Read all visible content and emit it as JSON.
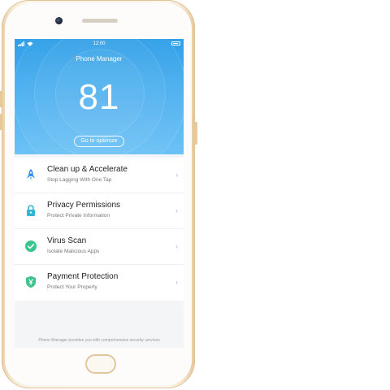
{
  "status_bar": {
    "time": "12:00"
  },
  "header": {
    "title": "Phone Manager",
    "score": "81",
    "optimize_label": "Go to optimize"
  },
  "items": [
    {
      "title": "Clean up & Accelerate",
      "subtitle": "Stop Lagging With One Tap",
      "icon": "rocket-icon",
      "color": "#3a8ee6"
    },
    {
      "title": "Privacy Permissions",
      "subtitle": "Protect Private Information",
      "icon": "lock-icon",
      "color": "#2fb8d6"
    },
    {
      "title": "Virus Scan",
      "subtitle": "Isolate Malicious Apps",
      "icon": "virus-scan-icon",
      "color": "#3cc48e"
    },
    {
      "title": "Payment Protection",
      "subtitle": "Protect Your Property",
      "icon": "shield-yen-icon",
      "color": "#3cc48e"
    }
  ],
  "footer": {
    "note": "Phone Manager provides you with comprehensive security services"
  },
  "colors": {
    "accent": "#3aa6ee",
    "phone_body": "#f7ead6"
  }
}
